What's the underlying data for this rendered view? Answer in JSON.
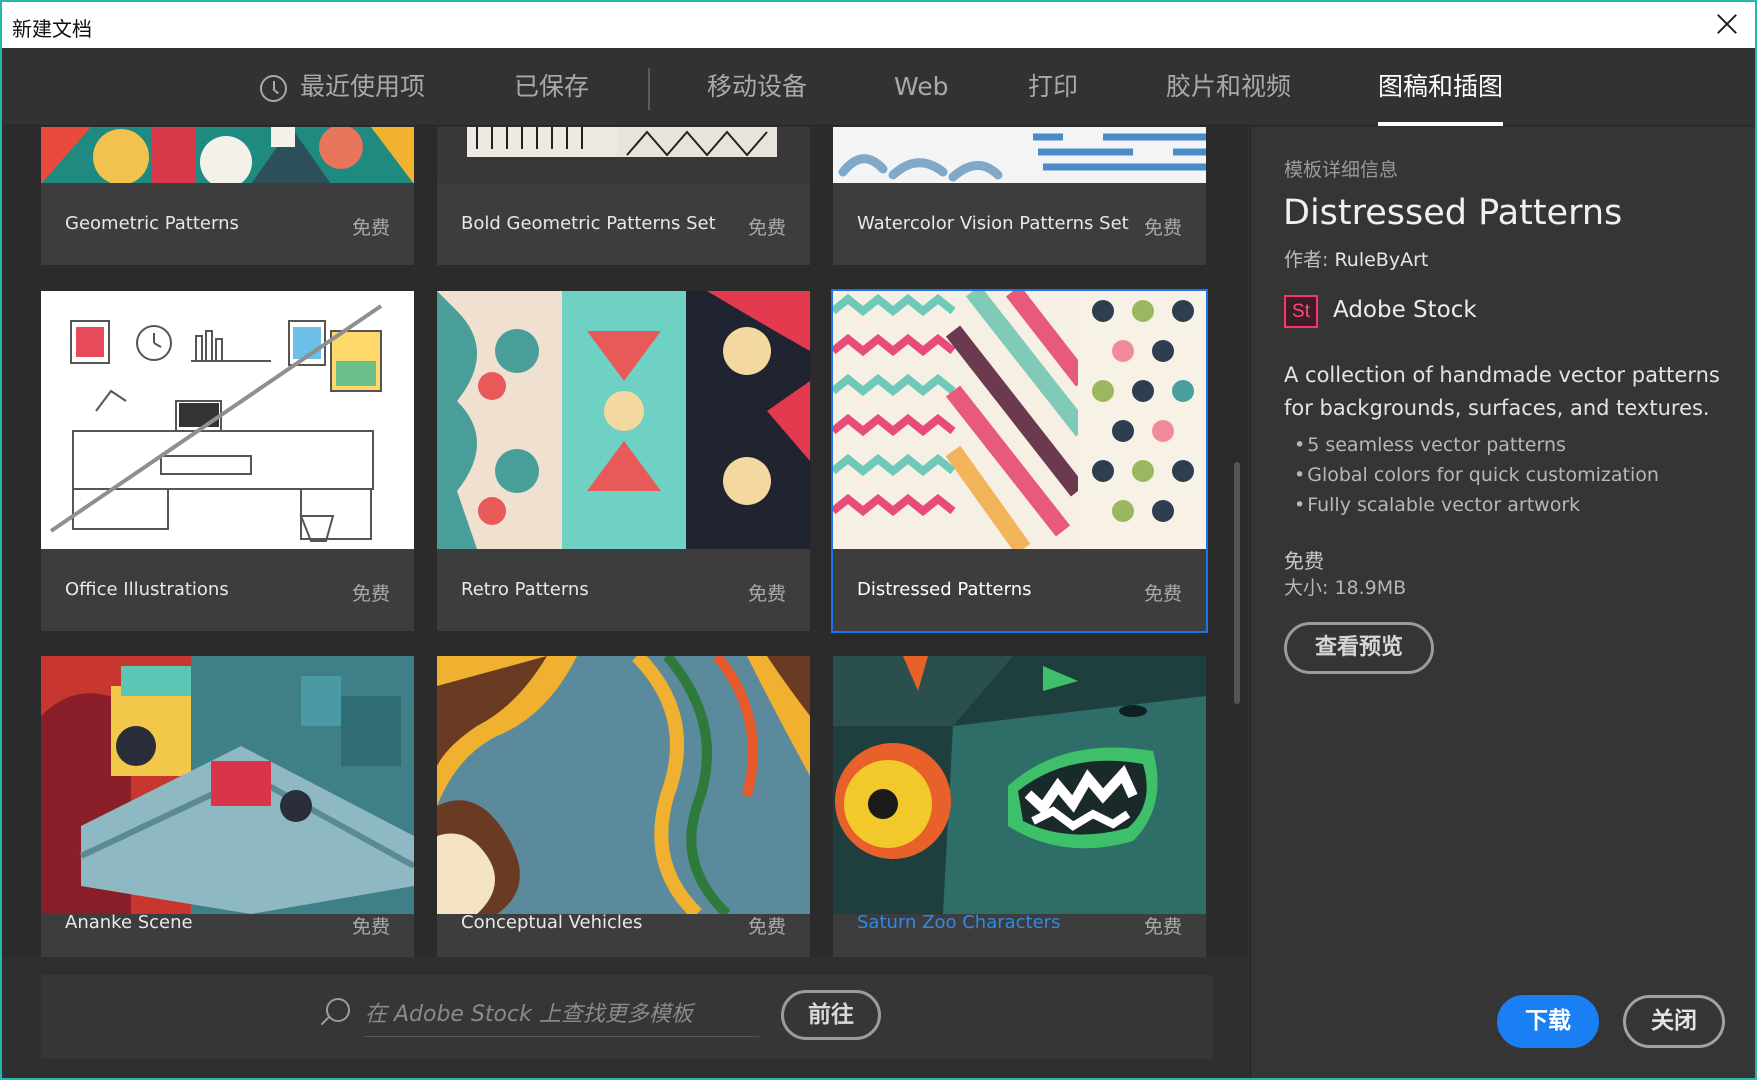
{
  "window": {
    "title": "新建文档"
  },
  "tabs": [
    {
      "label": "最近使用项",
      "icon": "clock-icon"
    },
    {
      "label": "已保存"
    },
    {
      "label": "移动设备"
    },
    {
      "label": "Web"
    },
    {
      "label": "打印"
    },
    {
      "label": "胶片和视频"
    },
    {
      "label": "图稿和插图",
      "active": true
    }
  ],
  "templates": [
    {
      "name": "Geometric Patterns",
      "price": "免费"
    },
    {
      "name": "Bold Geometric Patterns Set",
      "price": "免费"
    },
    {
      "name": "Watercolor Vision Patterns Set",
      "price": "免费"
    },
    {
      "name": "Office Illustrations",
      "price": "免费"
    },
    {
      "name": "Retro Patterns",
      "price": "免费"
    },
    {
      "name": "Distressed Patterns",
      "price": "免费",
      "selected": true
    },
    {
      "name": "Ananke Scene",
      "price": "免费"
    },
    {
      "name": "Conceptual Vehicles",
      "price": "免费"
    },
    {
      "name": "Saturn Zoo Characters",
      "price": "免费"
    }
  ],
  "search": {
    "placeholder": "在 Adobe Stock 上查找更多模板",
    "go_label": "前往"
  },
  "details": {
    "section_label": "模板详细信息",
    "title": "Distressed Patterns",
    "author_prefix": "作者:",
    "author": "RuleByArt",
    "source_icon": "St",
    "source": "Adobe Stock",
    "description": "A collection of handmade vector patterns for backgrounds, surfaces, and textures.",
    "bullets": [
      "5 seamless vector patterns",
      "Global colors for quick customization",
      "Fully scalable vector artwork"
    ],
    "price": "免费",
    "size": "大小: 18.9MB",
    "preview_label": "查看预览"
  },
  "actions": {
    "download_label": "下载",
    "close_label": "关闭"
  },
  "colors": {
    "accent": "#1a7ff2",
    "window_border": "#26b6b0",
    "adobe_stock": "#ff3366"
  }
}
